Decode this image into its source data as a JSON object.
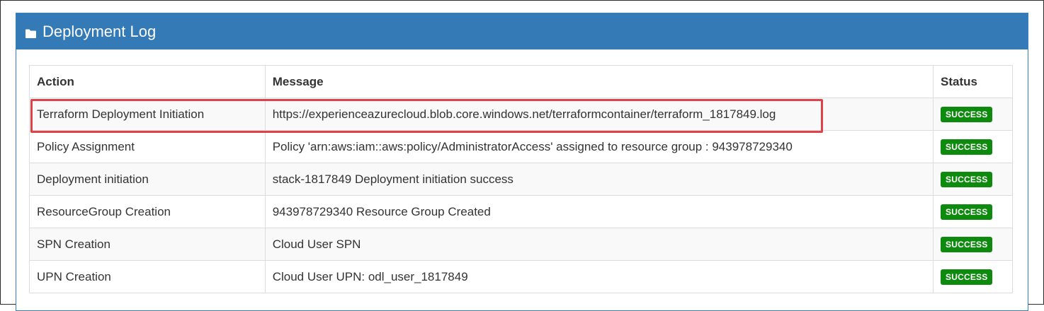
{
  "panel": {
    "title": "Deployment Log",
    "icon": "folder-icon"
  },
  "table": {
    "headers": {
      "action": "Action",
      "message": "Message",
      "status": "Status"
    },
    "rows": [
      {
        "action": "Terraform Deployment Initiation",
        "message": "https://experienceazurecloud.blob.core.windows.net/terraformcontainer/terraform_1817849.log",
        "status": "SUCCESS"
      },
      {
        "action": "Policy Assignment",
        "message": "Policy 'arn:aws:iam::aws:policy/AdministratorAccess' assigned to resource group : 943978729340",
        "status": "SUCCESS"
      },
      {
        "action": "Deployment initiation",
        "message": "stack-1817849 Deployment initiation success",
        "status": "SUCCESS"
      },
      {
        "action": "ResourceGroup Creation",
        "message": "943978729340 Resource Group Created",
        "status": "SUCCESS"
      },
      {
        "action": "SPN Creation",
        "message": "Cloud User SPN",
        "status": "SUCCESS"
      },
      {
        "action": "UPN Creation",
        "message": "Cloud User UPN: odl_user_1817849",
        "status": "SUCCESS"
      }
    ]
  },
  "colors": {
    "header_bg": "#337ab7",
    "success_badge": "#0e8a0e",
    "highlight": "#e0424a"
  }
}
